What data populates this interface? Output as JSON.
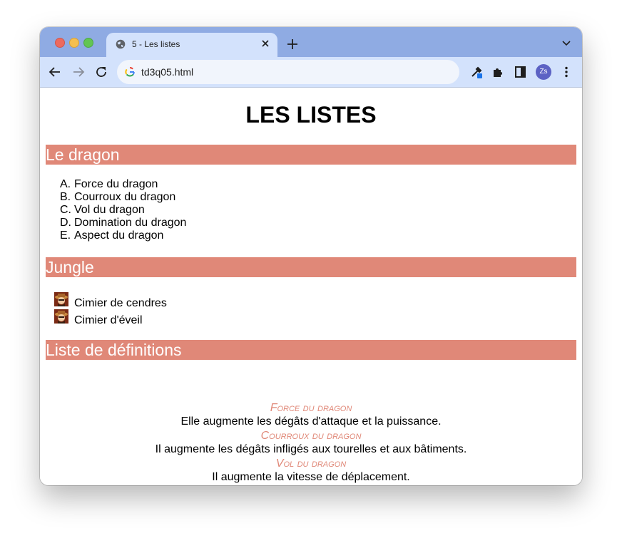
{
  "browser": {
    "tab_title": "5 - Les listes",
    "url": "td3q05.html",
    "profile_initials": "Zs"
  },
  "page": {
    "title": "LES LISTES",
    "sections": {
      "dragon": {
        "heading": "Le dragon",
        "items": [
          {
            "marker": "A.",
            "text": "Force du dragon"
          },
          {
            "marker": "B.",
            "text": "Courroux du dragon"
          },
          {
            "marker": "C.",
            "text": "Vol du dragon"
          },
          {
            "marker": "D.",
            "text": "Domination du dragon"
          },
          {
            "marker": "E.",
            "text": "Aspect du dragon"
          }
        ]
      },
      "jungle": {
        "heading": "Jungle",
        "items": [
          {
            "text": "Cimier de cendres"
          },
          {
            "text": "Cimier d'éveil"
          }
        ]
      },
      "definitions": {
        "heading": "Liste de définitions",
        "entries": [
          {
            "term": "Force du dragon",
            "desc": "Elle augmente les dégâts d'attaque et la puissance."
          },
          {
            "term": "Courroux du dragon",
            "desc": "Il augmente les dégâts infligés aux tourelles et aux bâtiments."
          },
          {
            "term": "Vol du dragon",
            "desc": "Il augmente la vitesse de déplacement."
          }
        ]
      }
    }
  },
  "colors": {
    "heading_bg": "#e08878",
    "term_color": "#e08878",
    "tabbar_bg": "#8fabe3",
    "toolbar_bg": "#d3e2fc"
  }
}
